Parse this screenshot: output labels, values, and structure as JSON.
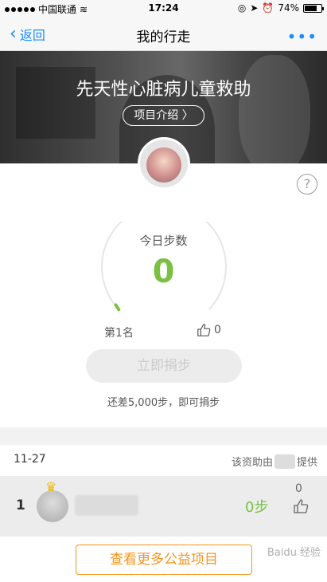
{
  "status_bar": {
    "carrier": "中国联通",
    "time": "17:24",
    "battery": "74%",
    "battery_level": 0.74
  },
  "nav": {
    "back_label": "返回",
    "title": "我的行走",
    "more_icon": "more-dots-icon"
  },
  "banner": {
    "title": "先天性心脏病儿童救助",
    "project_intro_label": "项目介绍 〉"
  },
  "steps": {
    "label": "今日步数",
    "value": "0",
    "rank": "第1名",
    "likes": "0",
    "progress": 0.0
  },
  "donate": {
    "button_label": "立即捐步",
    "hint": "还差5,000步，即可捐步"
  },
  "ranking": {
    "date": "11-27",
    "sponsor_prefix": "该资助由",
    "sponsor_suffix": "提供",
    "rows": [
      {
        "rank": "1",
        "steps": "0步",
        "likes": "0"
      }
    ]
  },
  "footer": {
    "more_projects_label": "查看更多公益项目"
  },
  "colors": {
    "accent_green": "#7ac143",
    "link_blue": "#1a8cff",
    "orange": "#f7941d"
  }
}
